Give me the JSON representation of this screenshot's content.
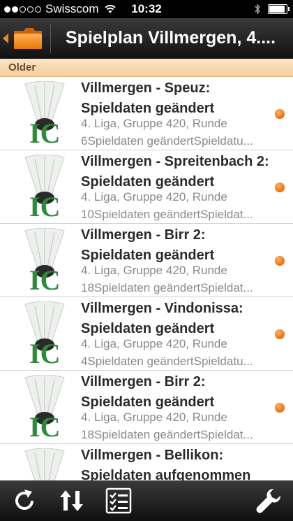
{
  "status_bar": {
    "carrier": "Swisscom",
    "time": "10:32"
  },
  "nav": {
    "title": "Spielplan Villmergen, 4...."
  },
  "section": {
    "label": "Older"
  },
  "items": [
    {
      "title": "Villmergen - Speuz: Spieldaten geändert",
      "subtitle": "4. Liga, Gruppe 420, Runde\n6Spieldaten geändertSpieldatu...",
      "unread": true
    },
    {
      "title": "Villmergen - Spreitenbach 2: Spieldaten geändert",
      "subtitle": "4. Liga, Gruppe 420, Runde\n10Spieldaten geändertSpieldat...",
      "unread": true
    },
    {
      "title": "Villmergen - Birr 2: Spieldaten geändert",
      "subtitle": "4. Liga, Gruppe 420, Runde\n18Spieldaten geändertSpieldat...",
      "unread": true
    },
    {
      "title": "Villmergen - Vindonissa: Spieldaten geändert",
      "subtitle": "4. Liga, Gruppe 420, Runde\n4Spieldaten geändertSpieldatu...",
      "unread": true
    },
    {
      "title": "Villmergen - Birr 2: Spieldaten geändert",
      "subtitle": "4. Liga, Gruppe 420, Runde\n18Spieldaten geändertSpieldat...",
      "unread": true
    },
    {
      "title": "Villmergen - Bellikon: Spieldaten aufgenommen",
      "subtitle": "",
      "unread": false
    }
  ],
  "toolbar": {
    "icons": [
      "refresh-icon",
      "sort-icon",
      "checklist-icon",
      "wrench-icon"
    ]
  },
  "colors": {
    "accent": "#f06a00",
    "header_bg": "#f6cf9f",
    "bar_bg": "#1a1a1a"
  }
}
